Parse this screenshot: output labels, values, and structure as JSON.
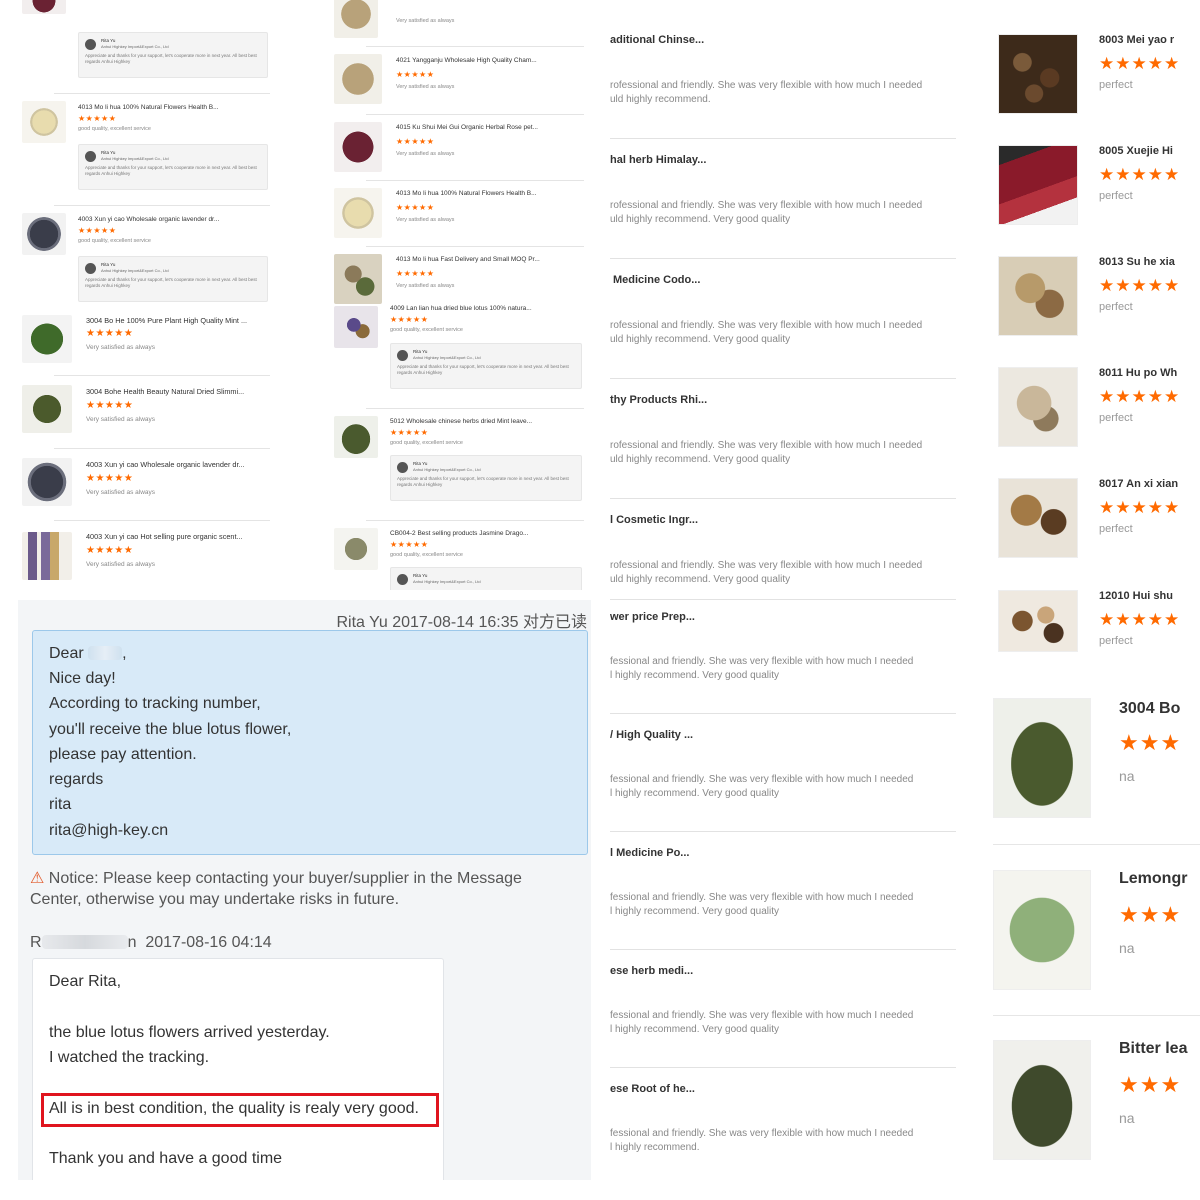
{
  "colors": {
    "star": "#ff6a00",
    "highlight": "#e0141e",
    "bubble": "#d8eaf8"
  },
  "panelA": {
    "replies": [
      {
        "name": "Rita Yu",
        "company": "Anhui Highkey Import&Export Co., Ltd",
        "text": "Appreciate and thanks for your support, let's cooperate more in next year. All best best regards Anhui Highkey"
      },
      {
        "name": "Rita Yu",
        "company": "Anhui Highkey Import&Export Co., Ltd",
        "text": "Appreciate and thanks for your support, let's cooperate more in next year. All best best regards Anhui Highkey"
      },
      {
        "name": "Rita Yu",
        "company": "Anhui Highkey Import&Export Co., Ltd",
        "text": "Appreciate and thanks for your support, let's cooperate more in next year. All best best regards Anhui Highkey"
      }
    ],
    "items": [
      {
        "title": "4013 Mo li hua 100% Natural Flowers Health B...",
        "stars": "★★★★★",
        "note": "good quality, excellent service"
      },
      {
        "title": "4003 Xun yi cao Wholesale organic lavender dr...",
        "stars": "★★★★★",
        "note": "good quality, excellent service"
      },
      {
        "title": "3004 Bo He 100% Pure Plant High Quality Mint ...",
        "stars": "★★★★★",
        "note": "Very satisfied as always"
      },
      {
        "title": "3004 Bohe Health Beauty Natural Dried Slimmi...",
        "stars": "★★★★★",
        "note": "Very satisfied as always"
      },
      {
        "title": "4003 Xun yi cao Wholesale organic lavender dr...",
        "stars": "★★★★★",
        "note": "Very satisfied as always"
      },
      {
        "title": "4003 Xun yi cao Hot selling pure organic scent...",
        "stars": "★★★★★",
        "note": "Very satisfied as always"
      }
    ]
  },
  "panelB": {
    "top_note": "Very satisfied as always",
    "items": [
      {
        "title": "4021 Yangganju Wholesale High Quality Cham...",
        "stars": "★★★★★",
        "note": "Very satisfied as always"
      },
      {
        "title": "4015 Ku Shui Mei Gui Organic Herbal Rose pet...",
        "stars": "★★★★★",
        "note": "Very satisfied as always"
      },
      {
        "title": "4013 Mo li hua 100% Natural Flowers Health B...",
        "stars": "★★★★★",
        "note": "Very satisfied as always"
      },
      {
        "title": "4013 Mo li hua Fast Delivery and Small MOQ Pr...",
        "stars": "★★★★★",
        "note": "Very satisfied as always"
      },
      {
        "title": "4009 Lan lian hua dried blue lotus 100% natura...",
        "stars": "★★★★★",
        "note": "good quality, excellent service"
      },
      {
        "title": "5012 Wholesale chinese herbs dried Mint leave...",
        "stars": "★★★★★",
        "note": "good quality, excellent service"
      },
      {
        "title": "CB004-2 Best selling products Jasmine Drago...",
        "stars": "★★★★★",
        "note": "good quality, excellent service"
      }
    ],
    "replies": [
      {
        "name": "Rita Yu",
        "company": "Anhui Highkey Import&Export Co., Ltd",
        "text": "Appreciate and thanks for your support, let's cooperate more in next year. All best best regards Anhui Highkey"
      },
      {
        "name": "Rita Yu",
        "company": "Anhui Highkey Import&Export Co., Ltd",
        "text": "Appreciate and thanks for your support, let's cooperate more in next year. All best best regards Anhui Highkey"
      },
      {
        "name": "Rita Yu",
        "company": "Anhui Highkey Import&Export Co., Ltd"
      }
    ]
  },
  "chat": {
    "header": "Rita Yu   2017-08-14 16:35  对方已读",
    "msg1": [
      "Dear",
      "Nice day!",
      "According to tracking number,",
      "you'll receive the blue lotus flower,",
      "please pay attention.",
      "regards",
      "rita",
      "rita@high-key.cn"
    ],
    "notice_icon": "⚠",
    "notice": "Notice: Please keep contacting your buyer/supplier in the Message Center, otherwise you may undertake risks in future.",
    "sender2_initial": "R",
    "sender2_tail": "n",
    "time2": "2017-08-16 04:14",
    "msg2": [
      "Dear Rita,",
      "the blue lotus flowers arrived yesterday.",
      "I watched the tracking.",
      "All is in best condition, the quality is realy very good.",
      "Thank you and have a good time"
    ]
  },
  "panelC": {
    "items": [
      {
        "title": "aditional Chinse...",
        "desc1": "rofessional and friendly. She was very flexible with how much I needed",
        "desc2": "uld highly recommend."
      },
      {
        "title": "hal herb Himalay...",
        "desc1": "rofessional and friendly. She was very flexible with how much I needed",
        "desc2": "uld highly recommend. Very good quality"
      },
      {
        "title": "Medicine Codo...",
        "desc1": "rofessional and friendly. She was very flexible with how much I needed",
        "desc2": "uld highly recommend. Very good quality"
      },
      {
        "title": "thy Products Rhi...",
        "desc1": "rofessional and friendly. She was very flexible with how much I needed",
        "desc2": "uld highly recommend. Very good quality"
      },
      {
        "title": "l Cosmetic Ingr...",
        "desc1": "rofessional and friendly. She was very flexible with how much I needed",
        "desc2": "uld highly recommend. Very good quality"
      },
      {
        "title": "wer price Prep...",
        "desc1": "fessional and friendly. She was very flexible with how much I needed",
        "desc2": "l highly recommend. Very good quality"
      },
      {
        "title": "/ High Quality ...",
        "desc1": "fessional and friendly. She was very flexible with how much I needed",
        "desc2": "l highly recommend. Very good quality"
      },
      {
        "title": "l Medicine Po...",
        "desc1": "fessional and friendly. She was very flexible with how much I needed",
        "desc2": "l highly recommend. Very good quality"
      },
      {
        "title": "ese herb medi...",
        "desc1": "fessional and friendly. She was very flexible with how much I needed",
        "desc2": "l highly recommend. Very good quality"
      },
      {
        "title": "ese Root of he...",
        "desc1": "fessional and friendly. She was very flexible with how much I needed",
        "desc2": "l highly recommend."
      }
    ]
  },
  "panelD": {
    "items": [
      {
        "title": "8003 Mei yao r",
        "stars": "★★★★★",
        "sub": "perfect"
      },
      {
        "title": "8005 Xuejie Hi",
        "stars": "★★★★★",
        "sub": "perfect"
      },
      {
        "title": "8013 Su he xia",
        "stars": "★★★★★",
        "sub": "perfect"
      },
      {
        "title": "8011 Hu po Wh",
        "stars": "★★★★★",
        "sub": "perfect"
      },
      {
        "title": "8017 An xi xian",
        "stars": "★★★★★",
        "sub": "perfect"
      },
      {
        "title": "12010 Hui shu",
        "stars": "★★★★★",
        "sub": "perfect"
      }
    ],
    "big_items": [
      {
        "title": "3004 Bo",
        "stars": "★★★",
        "sub": "na"
      },
      {
        "title": "Lemongr",
        "stars": "★★★",
        "sub": "na"
      },
      {
        "title": "Bitter lea",
        "stars": "★★★",
        "sub": "na"
      }
    ]
  }
}
